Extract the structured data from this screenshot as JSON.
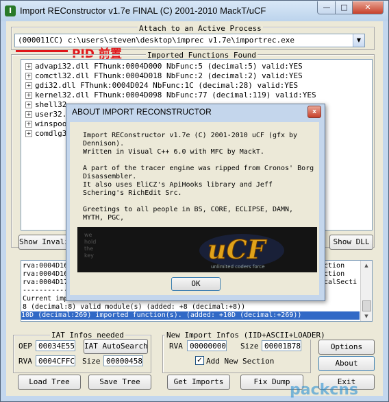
{
  "window": {
    "title": "Import REConstructor v1.7e FINAL (C) 2001-2010 MackT/uCF",
    "minimize": "—",
    "maximize": "□",
    "close": "✕"
  },
  "attach": {
    "label": "Attach to an Active Process",
    "selected": "(000011CC) c:\\users\\steven\\desktop\\imprec v1.7e\\importrec.exe",
    "annotation": "PID 前置"
  },
  "imports": {
    "label": "Imported Functions Found",
    "rows": [
      "advapi32.dll FThunk:0004D000 NbFunc:5 (decimal:5) valid:YES",
      "comctl32.dll FThunk:0004D018 NbFunc:2 (decimal:2) valid:YES",
      "gdi32.dll FThunk:0004D024 NbFunc:1C (decimal:28) valid:YES",
      "kernel32.dll FThunk:0004D098 NbFunc:77 (decimal:119) valid:YES",
      "shell32",
      "user32.",
      "winspoo",
      "comdlg3"
    ]
  },
  "buttons": {
    "show_invalid": "Show Invali",
    "show_dll": "Show DLL"
  },
  "log": {
    "lines": [
      "rva:0004D16",
      "rva:0004D16",
      "rva:0004D17",
      "-----------",
      "Current imports:",
      "8 (decimal:8) valid module(s) (added: +8 (decimal:+8))",
      "10D (decimal:269) imported function(s). (added: +10D (decimal:+269))"
    ],
    "right_fragments": [
      "ction",
      "ction",
      "calSecti"
    ]
  },
  "iat": {
    "label": "IAT Infos needed",
    "oep_label": "OEP",
    "oep": "00034E55",
    "autosearch": "IAT AutoSearch",
    "rva_label": "RVA",
    "rva": "0004CFFC",
    "size_label": "Size",
    "size": "00000458"
  },
  "new_import": {
    "label": "New Import Infos (IID+ASCII+LOADER)",
    "rva_label": "RVA",
    "rva": "00000000",
    "size_label": "Size",
    "size": "00001B78",
    "add_section_label": "Add New Section",
    "add_section_checked": true,
    "check_mark": "✓"
  },
  "side": {
    "options": "Options",
    "about": "About",
    "exit": "Exit"
  },
  "bottom": {
    "load_tree": "Load Tree",
    "save_tree": "Save Tree",
    "get_imports": "Get Imports",
    "fix_dump": "Fix Dump"
  },
  "about_dialog": {
    "title": "ABOUT IMPORT RECONSTRUCTOR",
    "close": "x",
    "lines": [
      "Import REConstructor v1.7e (C) 2001-2010 uCF (gfx by",
      "Dennison).",
      "Written in Visual C++ 6.0 with MFC by MackT.",
      "",
      "A part of the tracer engine was ripped from Cronos' Borg",
      "Disassembler.",
      "It also uses EliCZ's ApiHooks library and Jeff",
      "Schering's RichEdit Src.",
      "",
      "Greetings to all people in BS, CORE, ECLIPSE, DAMN,",
      "MYTH, PGC,"
    ],
    "banner_logo": "uCF",
    "banner_text": [
      "we",
      "hold",
      "the",
      "key"
    ],
    "banner_tagline": "unlimited coders force",
    "ok": "OK"
  },
  "watermark": "packcns",
  "colors": {
    "accent_red": "#e0161a",
    "selection_blue": "#3169c6",
    "banner_gold": "#e0a21a"
  }
}
